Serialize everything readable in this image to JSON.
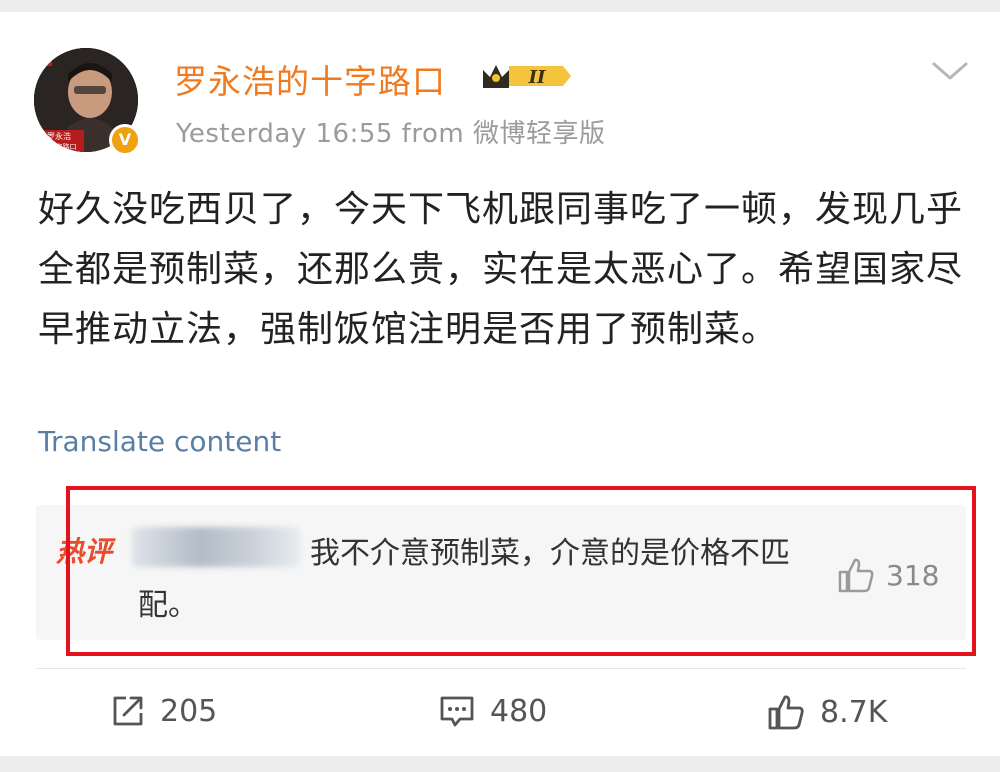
{
  "post": {
    "username": "罗永浩的十字路口",
    "vip_level": "II",
    "verified_mark": "V",
    "avatar_caption": [
      "罗永浩",
      "的十字路口"
    ],
    "meta": "Yesterday 16:55  from 微博轻享版",
    "text": "好久没吃西贝了，今天下飞机跟同事吃了一顿，发现几乎全都是预制菜，还那么贵，实在是太恶心了。希望国家尽早推动立法，强制饭馆注明是否用了预制菜。",
    "translate_label": "Translate content"
  },
  "hot_comment": {
    "label": "热评",
    "text": "我不介意预制菜，介意的是价格不匹配。",
    "likes": "318"
  },
  "actions": {
    "reposts": "205",
    "comments": "480",
    "likes": "8.7K"
  },
  "colors": {
    "username": "#f07a20",
    "link": "#5a7fa6",
    "highlight_box": "#e3121c",
    "hot_label": "#e84c2c"
  },
  "icons": {
    "more": "chevron-down-icon",
    "repost": "repost-icon",
    "comment": "comment-icon",
    "like": "thumbs-up-icon"
  }
}
